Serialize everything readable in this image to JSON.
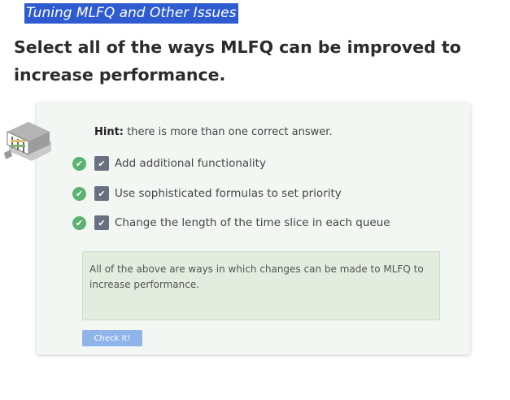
{
  "section_title": "Tuning MLFQ and Other Issues",
  "question": "Select all of the ways MLFQ can be improved to increase performance.",
  "hint": {
    "label": "Hint:",
    "text": " there is more than one correct answer."
  },
  "options": [
    {
      "label": "Add additional functionality",
      "checked": true,
      "correct": true,
      "icon": "check-circle-icon"
    },
    {
      "label": "Use sophisticated formulas to set priority",
      "checked": true,
      "correct": true,
      "icon": "check-circle-icon"
    },
    {
      "label": "Change the length of the time slice in each queue",
      "checked": true,
      "correct": true,
      "icon": "check-circle-icon"
    }
  ],
  "feedback": "All of the above are ways in which changes can be made to MLFQ to increase performance.",
  "check_button": "Check It!",
  "colors": {
    "title_highlight": "#2f5bd1",
    "correct_green": "#5cb270",
    "checkbox": "#6b7080",
    "feedback_bg": "#e2ede0",
    "button": "#8eb4ea"
  },
  "icons": {
    "checkmark": "✔",
    "mascot": "robot-icon"
  }
}
